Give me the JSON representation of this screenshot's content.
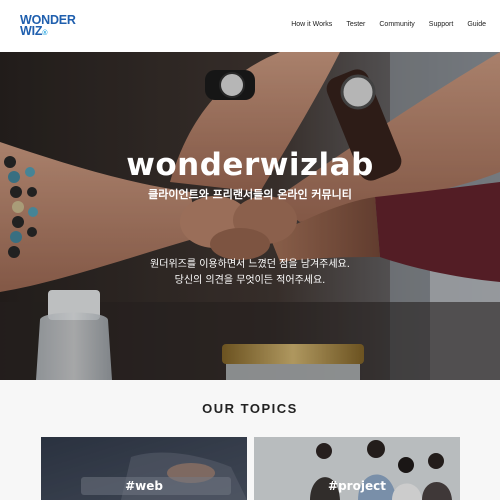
{
  "logo": {
    "line1": "WONDER",
    "line2": "WIZ",
    "mark": "®"
  },
  "nav": {
    "items": [
      {
        "label": "How it Works"
      },
      {
        "label": "Tester"
      },
      {
        "label": "Community"
      },
      {
        "label": "Support"
      },
      {
        "label": "Guide"
      }
    ]
  },
  "hero": {
    "title": "wonderwizlab",
    "subtitle": "클라이언트와 프리랜서들의 온라인 커뮤니티",
    "message_line1": "원더위즈를 이용하면서 느꼈던 점을 남겨주세요.",
    "message_line2": "당신의 의견을 무엇이든 적어주세요."
  },
  "topics": {
    "title": "OUR TOPICS",
    "cards": [
      {
        "label": "#web"
      },
      {
        "label": "#project"
      }
    ]
  },
  "colors": {
    "brand_blue": "#1f5fae",
    "brand_light_blue": "#2aa6e0"
  }
}
